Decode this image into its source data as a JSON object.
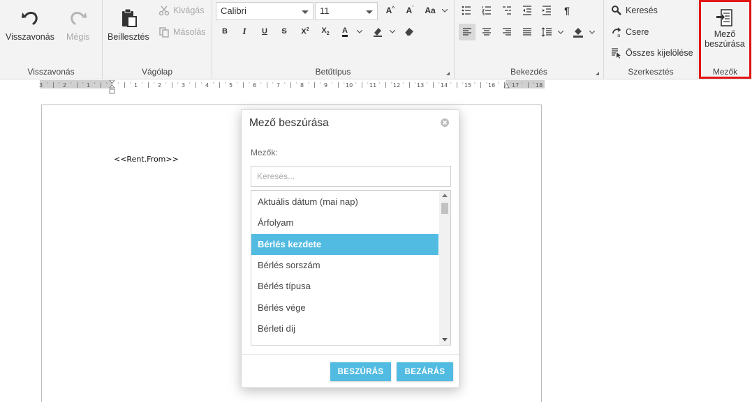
{
  "ribbon": {
    "undo_group": {
      "undo_label": "Visszavonás",
      "redo_label": "Mégis",
      "group_label": "Visszavonás"
    },
    "clipboard_group": {
      "paste_label": "Beillesztés",
      "cut_label": "Kivágás",
      "copy_label": "Másolás",
      "group_label": "Vágólap"
    },
    "font_group": {
      "font_name": "Calibri",
      "font_size": "11",
      "group_label": "Betűtípus"
    },
    "paragraph_group": {
      "group_label": "Bekezdés"
    },
    "editing_group": {
      "find_label": "Keresés",
      "replace_label": "Csere",
      "select_all_label": "Összes kijelölése",
      "group_label": "Szerkesztés"
    },
    "fields_group": {
      "insert_field_label_line1": "Mező",
      "insert_field_label_line2": "beszúrása",
      "group_label": "Mezők"
    }
  },
  "ruler": {
    "left_ticks": [
      "3",
      "2",
      "1"
    ],
    "right_ticks": [
      "1",
      "2",
      "3",
      "4",
      "5",
      "6",
      "7",
      "8",
      "9",
      "10",
      "11",
      "12",
      "13",
      "14",
      "15",
      "16",
      "17",
      "18"
    ]
  },
  "document": {
    "field_text": "<<Rent.From>>"
  },
  "dialog": {
    "title": "Mező beszúrása",
    "fields_label": "Mezők:",
    "search_placeholder": "Keresés...",
    "items": [
      "Aktuális dátum (mai nap)",
      "Árfolyam",
      "Bérlés kezdete",
      "Bérlés sorszám",
      "Bérlés típusa",
      "Bérlés vége",
      "Bérleti díj"
    ],
    "selected_index": 2,
    "insert_button": "BESZÚRÁS",
    "close_button": "BEZÁRÁS"
  },
  "colors": {
    "accent": "#52bbe2",
    "highlight_border": "#e31414",
    "ribbon_bg": "#f3f3f3"
  }
}
